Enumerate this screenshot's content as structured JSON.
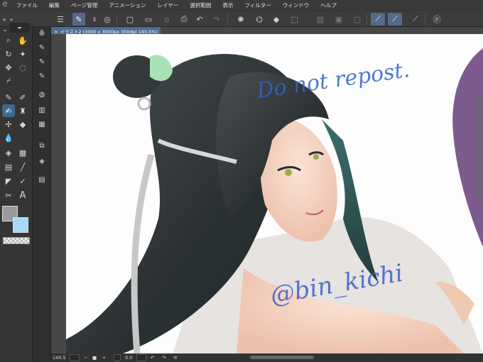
{
  "menubar": {
    "items": [
      "ファイル",
      "編集",
      "ページ管理",
      "アニメーション",
      "レイヤー",
      "選択範囲",
      "表示",
      "フィルター",
      "ウィンドウ",
      "ヘルプ"
    ]
  },
  "document": {
    "tab_close": "×",
    "tab_title": "イラスト2 (3000 x 3000px 350dpi 140.5%)"
  },
  "artwork": {
    "watermark_top": "Do not repost.",
    "watermark_handle": "@bin_kichi"
  },
  "status": {
    "zoom": "140.5",
    "angle": "0.0"
  },
  "colors": {
    "main_color": "#9a9a9a",
    "sub_color": "#a8d8f8",
    "tab_accent": "#4d6d93",
    "watermark_ink": "#3560c8"
  }
}
